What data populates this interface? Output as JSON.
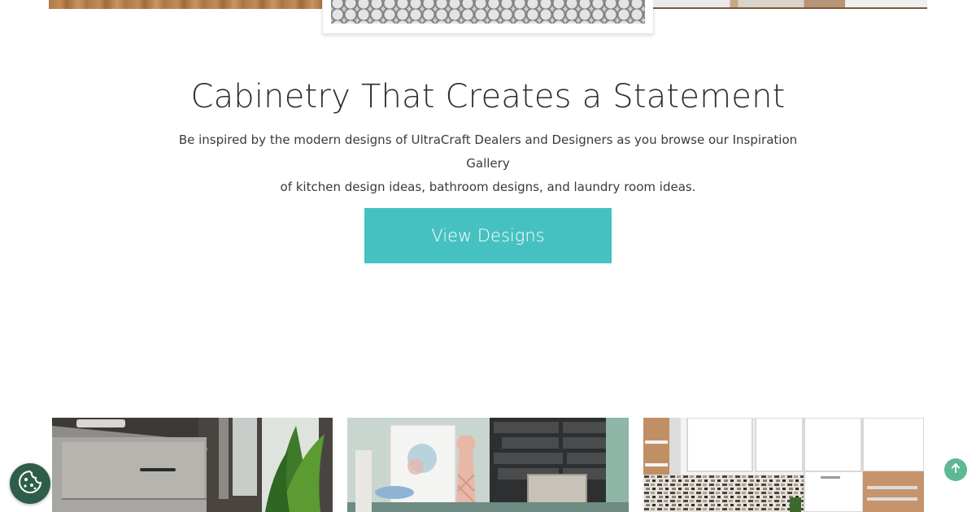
{
  "hero": {
    "headline": "Cabinetry That Creates a Statement",
    "intro_line_1": "Be inspired by the modern designs of UltraCraft Dealers and Designers as you browse our Inspiration Gallery",
    "intro_line_2": "of kitchen design ideas, bathroom designs, and laundry room ideas.",
    "cta_label": "View Designs"
  },
  "colors": {
    "accent": "#46c1c1",
    "cookie_button": "#2e5e4a",
    "scroll_top_button": "#5fb894",
    "headline_text": "#2d2d2d"
  },
  "icons": {
    "cookie": "cookie-icon",
    "scroll_top": "arrow-up-icon"
  }
}
